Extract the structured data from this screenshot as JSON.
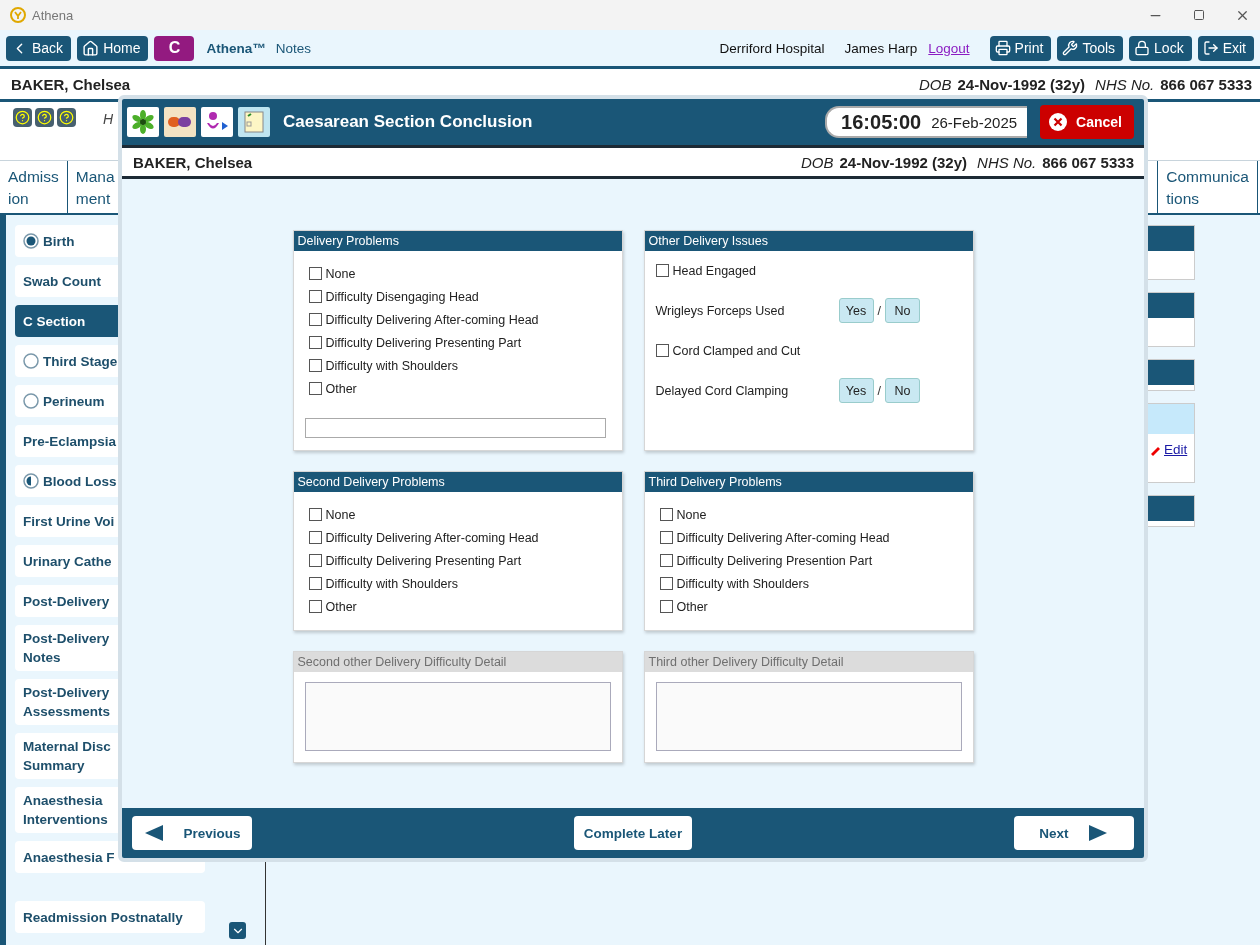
{
  "window": {
    "title": "Athena"
  },
  "toolbar": {
    "left_buttons": [
      {
        "label": "Back"
      },
      {
        "label": "Home"
      }
    ],
    "badge": "C",
    "app_name": "Athena™",
    "app_subtitle": "Notes",
    "hospital": "Derriford Hospital",
    "user": "James Harp",
    "logout": "Logout",
    "right_buttons": [
      {
        "label": "Print"
      },
      {
        "label": "Tools"
      },
      {
        "label": "Lock"
      },
      {
        "label": "Exit"
      }
    ]
  },
  "patient": {
    "name": "BAKER, Chelsea",
    "dob_label": "DOB",
    "dob": "24-Nov-1992 (32y)",
    "nhs_label": "NHS No.",
    "nhs": "866 067 5333"
  },
  "header_note": "H",
  "tabs": [
    {
      "lines": [
        "Admiss",
        "ion"
      ]
    },
    {
      "lines": [
        "Mana",
        "ment"
      ]
    },
    {
      "lines": [
        "Communica",
        "tions"
      ]
    }
  ],
  "sidebar": {
    "items": [
      {
        "lines": [
          "Birth"
        ],
        "kind": "complete",
        "selected": false
      },
      {
        "lines": [
          "Swab Count"
        ],
        "kind": "plain",
        "selected": false
      },
      {
        "lines": [
          "C Section"
        ],
        "kind": "plain",
        "selected": true
      },
      {
        "lines": [
          "Third Stage"
        ],
        "kind": "empty",
        "selected": false
      },
      {
        "lines": [
          "Perineum"
        ],
        "kind": "empty",
        "selected": false
      },
      {
        "lines": [
          "Pre-Eclampsia"
        ],
        "kind": "plain",
        "selected": false
      },
      {
        "lines": [
          "Blood Loss"
        ],
        "kind": "partial",
        "selected": false
      },
      {
        "lines": [
          "First Urine Voi"
        ],
        "kind": "plain",
        "selected": false
      },
      {
        "lines": [
          "Urinary Cathe"
        ],
        "kind": "plain",
        "selected": false
      },
      {
        "lines": [
          "Post-Delivery"
        ],
        "kind": "plain",
        "selected": false
      },
      {
        "lines": [
          "Post-Delivery",
          "Notes"
        ],
        "kind": "plain",
        "selected": false
      },
      {
        "lines": [
          "Post-Delivery",
          "Assessments"
        ],
        "kind": "plain",
        "selected": false
      },
      {
        "lines": [
          "Maternal Disc",
          "Summary"
        ],
        "kind": "plain",
        "selected": false
      },
      {
        "lines": [
          "Anaesthesia",
          "Interventions"
        ],
        "kind": "plain",
        "selected": false
      },
      {
        "lines": [
          "Anaesthesia F"
        ],
        "kind": "plain",
        "selected": false
      },
      {
        "lines": [
          "Readmission Postnatally"
        ],
        "kind": "plain",
        "selected": false
      }
    ]
  },
  "right_panels": [
    {
      "kind": "tall"
    },
    {
      "kind": "tall"
    },
    {
      "kind": "short"
    },
    {
      "kind": "edit",
      "link": "Edit"
    },
    {
      "kind": "short"
    }
  ],
  "modal": {
    "title": "Caesarean Section Conclusion",
    "time": "16:05:00",
    "date": "26-Feb-2025",
    "cancel": "Cancel",
    "patient": {
      "name": "BAKER, Chelsea",
      "dob_label": "DOB",
      "dob": "24-Nov-1992 (32y)",
      "nhs_label": "NHS No.",
      "nhs": "866 067 5333"
    },
    "cards": [
      {
        "kind": "checklist",
        "title": "Delivery Problems",
        "disabled": false,
        "has_field": true,
        "items": [
          {
            "label": "None",
            "checked": false
          },
          {
            "label": "Difficulty Disengaging Head",
            "checked": false
          },
          {
            "label": "Difficulty Delivering After-coming Head",
            "checked": false
          },
          {
            "label": "Difficulty Delivering Presenting Part",
            "checked": false
          },
          {
            "label": "Difficulty with Shoulders",
            "checked": false
          },
          {
            "label": "Other",
            "checked": false
          }
        ]
      },
      {
        "kind": "issues",
        "title": "Other Delivery Issues",
        "disabled": false,
        "items": [
          {
            "kind": "checkbox",
            "label": "Head Engaged",
            "checked": false
          },
          {
            "kind": "yesno",
            "label": "Wrigleys Forceps Used",
            "separator": "/",
            "options": [
              {
                "label": "Yes",
                "selected": false
              },
              {
                "label": "No",
                "selected": false
              }
            ]
          },
          {
            "kind": "checkbox",
            "label": "Cord Clamped and Cut",
            "checked": false
          },
          {
            "kind": "yesno",
            "label": "Delayed Cord Clamping",
            "separator": "/",
            "options": [
              {
                "label": "Yes",
                "selected": false
              },
              {
                "label": "No",
                "selected": false
              }
            ]
          }
        ]
      },
      {
        "kind": "checklist",
        "title": "Second Delivery Problems",
        "disabled": false,
        "has_field": false,
        "items": [
          {
            "label": "None",
            "checked": false
          },
          {
            "label": "Difficulty Delivering After-coming Head",
            "checked": false
          },
          {
            "label": "Difficulty Delivering Presenting Part",
            "checked": false
          },
          {
            "label": "Difficulty with Shoulders",
            "checked": false
          },
          {
            "label": "Other",
            "checked": false
          }
        ]
      },
      {
        "kind": "checklist",
        "title": "Third Delivery Problems",
        "disabled": false,
        "has_field": false,
        "items": [
          {
            "label": "None",
            "checked": false
          },
          {
            "label": "Difficulty Delivering After-coming Head",
            "checked": false
          },
          {
            "label": "Difficulty Delivering Presention Part",
            "checked": false
          },
          {
            "label": "Difficulty with Shoulders",
            "checked": false
          },
          {
            "label": "Other",
            "checked": false
          }
        ]
      },
      {
        "kind": "detail",
        "title": "Second other Delivery Difficulty Detail",
        "disabled": true
      },
      {
        "kind": "detail",
        "title": "Third other Delivery Difficulty Detail",
        "disabled": true
      }
    ],
    "footer": {
      "previous": "Previous",
      "later": "Complete Later",
      "next": "Next"
    }
  }
}
